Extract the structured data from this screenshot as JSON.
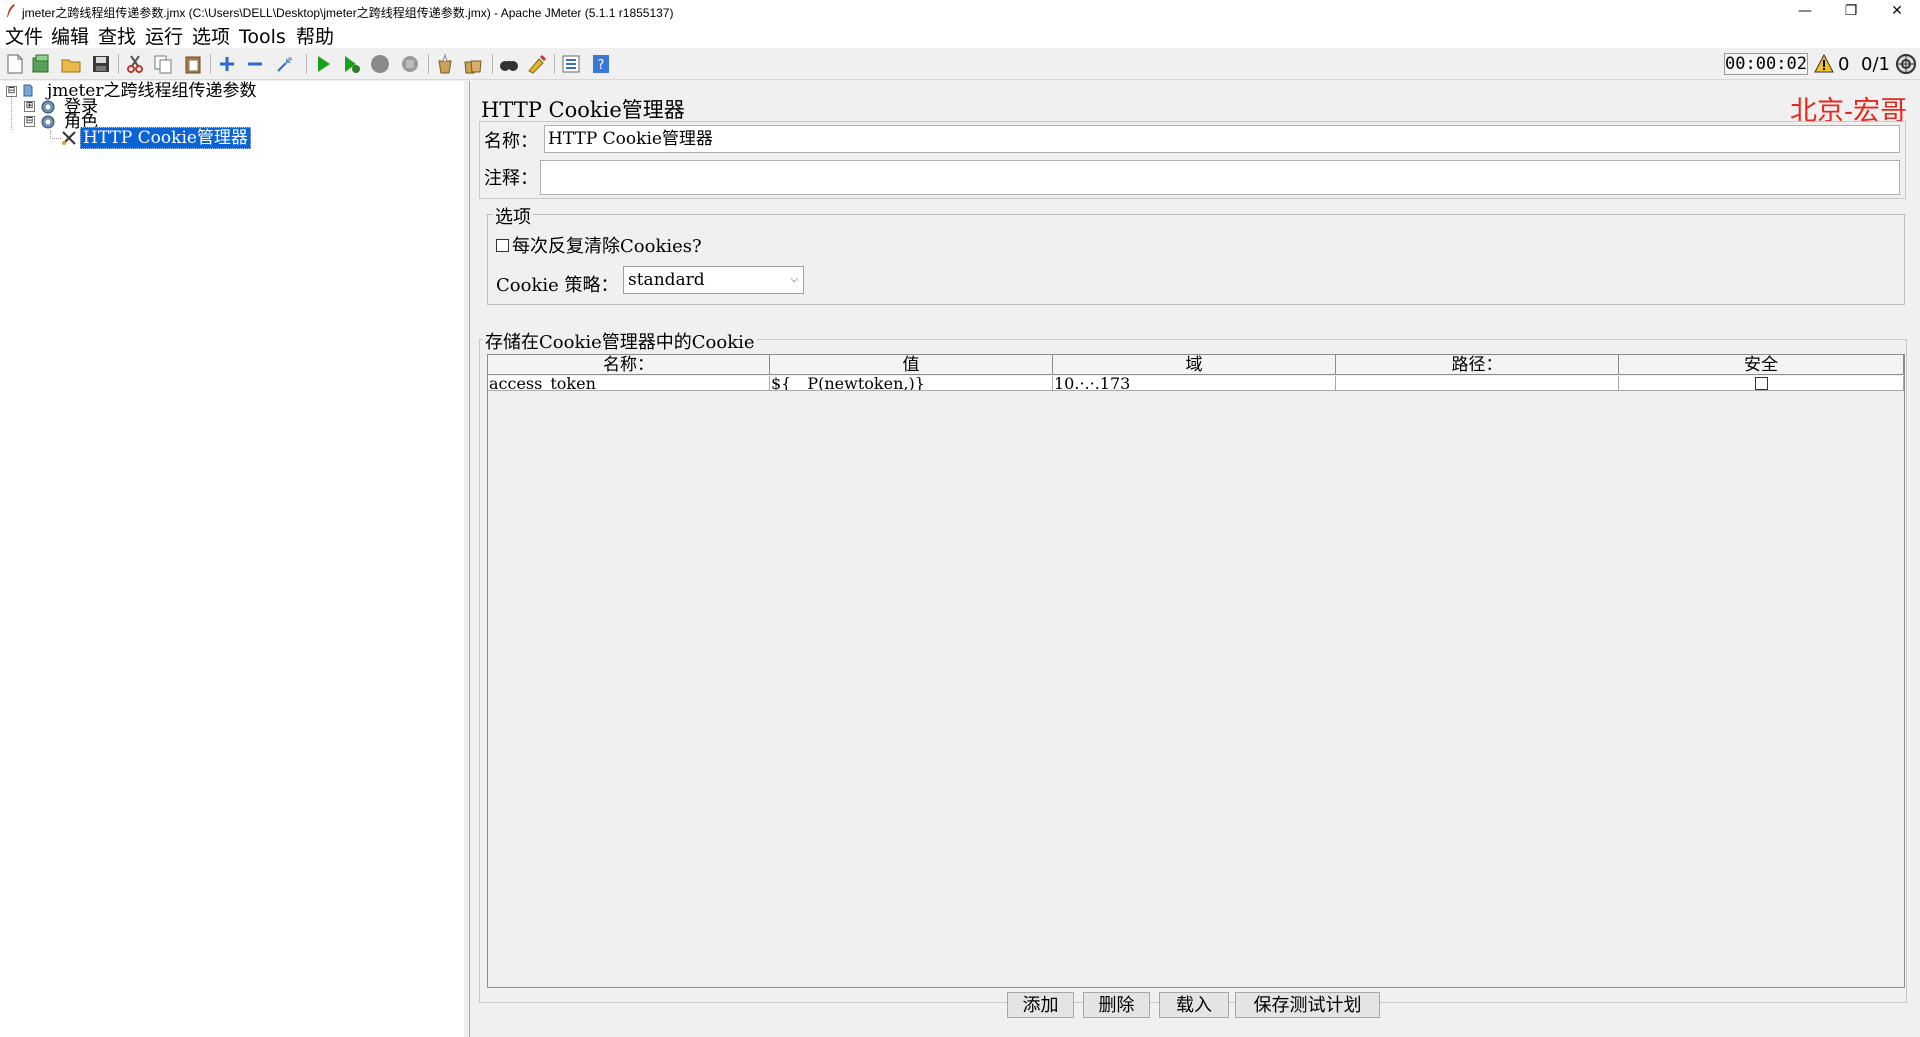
{
  "window": {
    "title": "jmeter之跨线程组传递参数.jmx (C:\\Users\\DELL\\Desktop\\jmeter之跨线程组传递参数.jmx) - Apache JMeter (5.1.1 r1855137)",
    "minimize": "—",
    "maximize": "❐",
    "close": "✕"
  },
  "menu": [
    "文件",
    "编辑",
    "查找",
    "运行",
    "选项",
    "Tools",
    "帮助"
  ],
  "toolbar": {
    "icons": [
      "new-icon",
      "templates-icon",
      "open-icon",
      "save-icon",
      "cut-icon",
      "copy-icon",
      "paste-icon",
      "expand-icon",
      "collapse-icon",
      "toggle-icon",
      "start-icon",
      "start-no-pause-icon",
      "stop-icon",
      "shutdown-icon",
      "clear-icon",
      "clear-all-icon",
      "search-icon",
      "reset-search-icon",
      "function-helper-icon",
      "help-icon"
    ],
    "timer": "00:00:02",
    "error_count": "0",
    "threads": "0/1"
  },
  "tree": {
    "root": "jmeter之跨线程组传递参数",
    "items": [
      "登录",
      "角色",
      "HTTP Cookie管理器"
    ],
    "toggles": [
      "⊟",
      "⊞",
      "⊟"
    ]
  },
  "panel": {
    "title": "HTTP Cookie管理器",
    "watermark": "北京-宏哥",
    "name_label": "名称：",
    "name_value": "HTTP Cookie管理器",
    "comment_label": "注释：",
    "comment_value": "",
    "options_title": "选项",
    "clear_each_iteration_label": "每次反复清除Cookies?",
    "clear_each_iteration_checked": false,
    "policy_label": "Cookie 策略：",
    "policy_value": "standard",
    "cookies_title": "存储在Cookie管理器中的Cookie"
  },
  "table": {
    "columns": [
      "名称：",
      "值",
      "域",
      "路径：",
      "安全"
    ],
    "rows": [
      {
        "name": "access_token",
        "value": "${__P(newtoken,)}",
        "domain": "10.·.·.173",
        "path": "",
        "secure": false
      }
    ]
  },
  "buttons": [
    "添加",
    "删除",
    "载入",
    "保存测试计划"
  ],
  "colors": {
    "selection": "#0a64d6",
    "watermark": "#e8271d",
    "start": "#1aa21a"
  }
}
